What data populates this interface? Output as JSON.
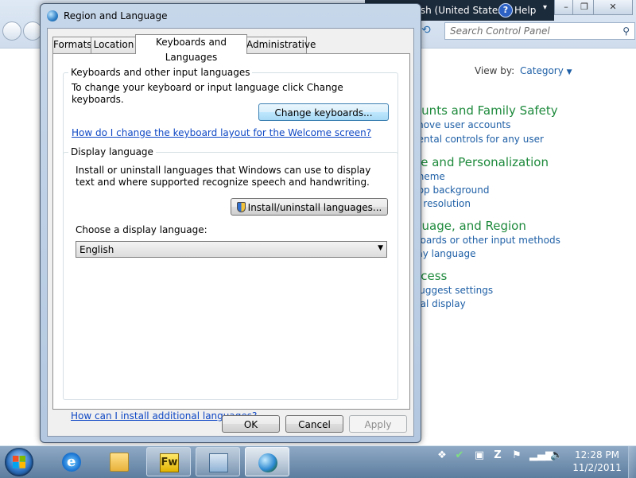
{
  "background_window": {
    "search_placeholder": "Search Control Panel",
    "view_by_label": "View by:",
    "view_by_value": "Category",
    "sections": [
      {
        "heading": "ounts and Family Safety",
        "links": [
          "move user accounts",
          "rental controls for any user"
        ]
      },
      {
        "heading": "ce and Personalization",
        "links": [
          "theme",
          "top background",
          "n resolution"
        ]
      },
      {
        "heading": "guage, and Region",
        "links": [
          "boards or other input methods",
          "lay language"
        ]
      },
      {
        "heading": "ccess",
        "links": [
          "suggest settings",
          "ual display"
        ]
      }
    ]
  },
  "language_bar": {
    "language": "EN English (United States)",
    "help_label": "Help"
  },
  "dialog": {
    "title": "Region and Language",
    "tabs": [
      "Formats",
      "Location",
      "Keyboards and Languages",
      "Administrative"
    ],
    "active_tab": "Keyboards and Languages",
    "keyboards_group": {
      "title": "Keyboards and other input languages",
      "description": "To change your keyboard or input language click Change keyboards.",
      "button": "Change keyboards...",
      "help_link": "How do I change the keyboard layout for the Welcome screen?"
    },
    "display_group": {
      "title": "Display language",
      "description": "Install or uninstall languages that Windows can use to display text and where supported recognize speech and handwriting.",
      "install_button": "Install/uninstall languages...",
      "choose_label": "Choose a display language:",
      "selected_language": "English"
    },
    "bottom_link": "How can I install additional languages?",
    "buttons": {
      "ok": "OK",
      "cancel": "Cancel",
      "apply": "Apply"
    }
  },
  "taskbar": {
    "fireworks_label": "Fw",
    "clock_time": "12:28 PM",
    "clock_date": "11/2/2011"
  }
}
